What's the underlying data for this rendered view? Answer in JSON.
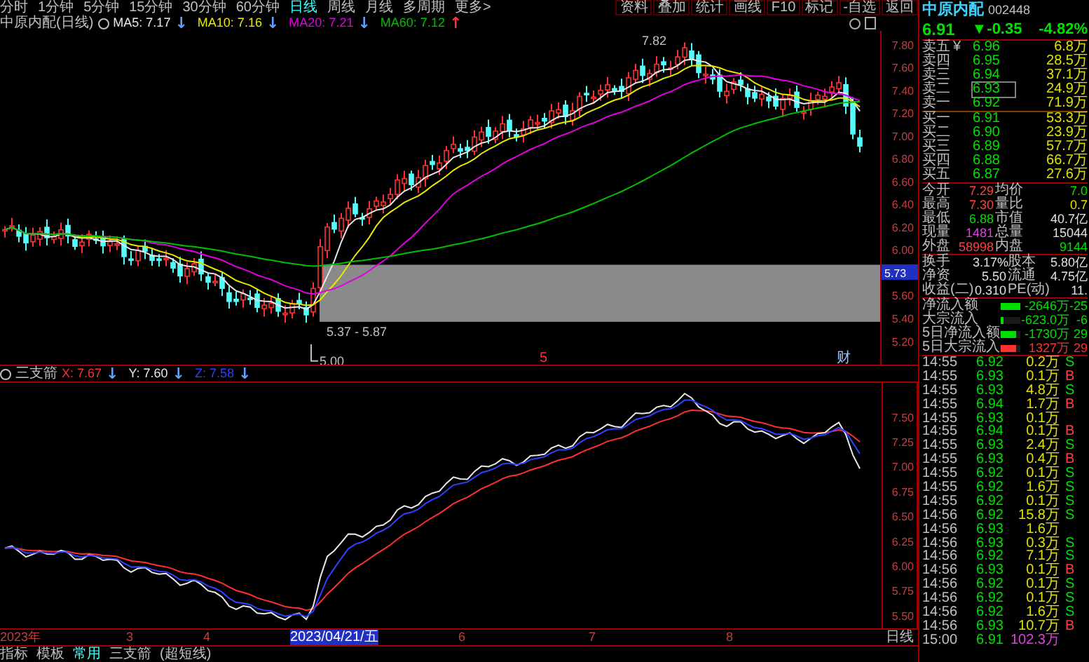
{
  "menu_bar": {
    "periods": [
      {
        "label": "分时",
        "selected": false
      },
      {
        "label": "1分钟",
        "selected": false
      },
      {
        "label": "5分钟",
        "selected": false
      },
      {
        "label": "15分钟",
        "selected": false
      },
      {
        "label": "30分钟",
        "selected": false
      },
      {
        "label": "60分钟",
        "selected": false
      },
      {
        "label": "日线",
        "selected": true
      },
      {
        "label": "周线",
        "selected": false
      },
      {
        "label": "月线",
        "selected": false
      },
      {
        "label": "多周期",
        "selected": false
      },
      {
        "label": "更多>",
        "selected": false
      }
    ],
    "tools": [
      "资料",
      "叠加",
      "统计",
      "画线",
      "F10",
      "标记",
      "-自选",
      "返回"
    ]
  },
  "price_chart": {
    "title": "中原内配(日线)",
    "ma_legend": [
      {
        "label": "MA5: 7.17",
        "arrow": {
          "text": "↓",
          "color": "#60a0ff"
        },
        "color": "#e8e8e8"
      },
      {
        "label": "MA10: 7.16",
        "arrow": {
          "text": "↓",
          "color": "#60a0ff"
        },
        "color": "#e8e800"
      },
      {
        "label": "MA20: 7.21",
        "arrow": {
          "text": "↓",
          "color": "#60a0ff"
        },
        "color": "#e000e0"
      },
      {
        "label": "MA60: 7.12",
        "arrow": {
          "text": "↑",
          "color": "#ff3030"
        },
        "color": "#00c000"
      }
    ],
    "y_labels": [
      "7.80",
      "7.60",
      "7.40",
      "7.20",
      "7.00",
      "6.80",
      "6.60",
      "6.40",
      "6.20",
      "6.00",
      "5.60",
      "5.40",
      "5.20"
    ],
    "cursor_price": "5.73",
    "annotations": [
      {
        "kind": "high",
        "text": "7.82"
      },
      {
        "kind": "gap",
        "text": "5.37 - 5.87"
      },
      {
        "kind": "low",
        "text": "5.00"
      }
    ],
    "event_marks": [
      {
        "text": "5",
        "color": "#ff3030"
      },
      {
        "text": "财",
        "color": "#a0c8ff"
      }
    ]
  },
  "indicator": {
    "name": "三支箭",
    "values": [
      {
        "label": "X: 7.67",
        "arrow": "↓",
        "color": "#ff3030"
      },
      {
        "label": "Y: 7.60",
        "arrow": "↓",
        "color": "#e8e8e8"
      },
      {
        "label": "Z: 7.58",
        "arrow": "↓",
        "color": "#3040ff"
      }
    ],
    "y_labels": [
      "7.50",
      "7.25",
      "7.00",
      "6.75",
      "6.50",
      "6.25",
      "6.00",
      "5.75",
      "5.50"
    ]
  },
  "date_axis": {
    "labels": [
      "2023年",
      "3",
      "4",
      "6",
      "7",
      "8"
    ],
    "cursor_date": "2023/04/21/五",
    "period": "日线"
  },
  "bottom_tabs": [
    {
      "label": "指标",
      "selected": false
    },
    {
      "label": "模板",
      "selected": false
    },
    {
      "label": "常用",
      "selected": true
    },
    {
      "label": "三支箭",
      "selected": false
    },
    {
      "label": "(超短线)",
      "selected": false
    }
  ],
  "quote": {
    "name": "中原内配",
    "code": "002448",
    "price": "6.91",
    "change": "▼-0.35",
    "change_pct": "-4.82%",
    "order_book": [
      {
        "label": "卖五",
        "mark": "¥",
        "price": "6.96",
        "volume": "6.8万",
        "selected": false
      },
      {
        "label": "卖四",
        "price": "6.95",
        "volume": "28.5万",
        "selected": false
      },
      {
        "label": "卖三",
        "price": "6.94",
        "volume": "37.1万",
        "selected": false
      },
      {
        "label": "卖二",
        "price": "6.93",
        "volume": "24.9万",
        "selected": true
      },
      {
        "label": "卖一",
        "price": "6.92",
        "volume": "71.9万",
        "selected": false
      },
      {
        "label": "买一",
        "price": "6.91",
        "volume": "53.3万",
        "selected": false
      },
      {
        "label": "买二",
        "price": "6.90",
        "volume": "23.9万",
        "selected": false
      },
      {
        "label": "买三",
        "price": "6.89",
        "volume": "57.7万",
        "selected": false
      },
      {
        "label": "买四",
        "price": "6.88",
        "volume": "66.7万",
        "selected": false
      },
      {
        "label": "买五",
        "price": "6.87",
        "volume": "27.6万",
        "selected": false
      }
    ],
    "stats": [
      {
        "left": {
          "label": "今开",
          "value": "7.29",
          "color": "#ff4040"
        },
        "right": {
          "label": "均价",
          "value": "7.0",
          "color": "#00e000"
        }
      },
      {
        "left": {
          "label": "最高",
          "value": "7.30",
          "color": "#ff4040"
        },
        "right": {
          "label": "量比",
          "value": "0.7",
          "color": "#e0e000"
        }
      },
      {
        "left": {
          "label": "最低",
          "value": "6.88",
          "color": "#00e000"
        },
        "right": {
          "label": "市值",
          "value": "40.7亿",
          "color": "#e0e0e0"
        }
      },
      {
        "left": {
          "label": "现量",
          "value": "1481",
          "color": "#e040e0"
        },
        "right": {
          "label": "总量",
          "value": "15044",
          "color": "#e0e0e0"
        }
      },
      {
        "left": {
          "label": "外盘",
          "value": "58998",
          "color": "#ff4040"
        },
        "right": {
          "label": "内盘",
          "value": "9144",
          "color": "#00e000"
        }
      }
    ],
    "fundamentals": [
      {
        "label": "换手",
        "value": "3.17%",
        "label2": "股本",
        "value2": "5.80亿"
      },
      {
        "label": "净资",
        "value": "5.50",
        "label2": "流通",
        "value2": "4.75亿"
      },
      {
        "label": "收益(二)",
        "value": "0.310",
        "label2": "PE(动)",
        "value2": "11."
      }
    ],
    "flows": [
      {
        "label": "净流入额",
        "level": 1,
        "color": "#00e000",
        "value": "-2646万",
        "extra": "-25"
      },
      {
        "label": "大宗流入",
        "level": 0.15,
        "color": "#00e000",
        "value": "-623.0万",
        "extra": "-6"
      },
      {
        "label": "5日净流入额",
        "level": 0.8,
        "color": "#00e000",
        "value": "-1730万",
        "extra": "29"
      },
      {
        "label": "5日大宗流入",
        "level": 0.8,
        "color": "#ff3030",
        "value": "1327万",
        "extra": "29"
      }
    ],
    "ticks": [
      {
        "time": "14:55",
        "price": "6.92",
        "volume": "0.2万",
        "side": "S",
        "color": "#00e000",
        "highlight": false
      },
      {
        "time": "14:55",
        "price": "6.93",
        "volume": "0.1万",
        "side": "B",
        "color": "#ff4040",
        "highlight": false
      },
      {
        "time": "14:55",
        "price": "6.93",
        "volume": "4.8万",
        "side": "S",
        "color": "#00e000",
        "highlight": false
      },
      {
        "time": "14:55",
        "price": "6.94",
        "volume": "1.7万",
        "side": "B",
        "color": "#ff4040",
        "highlight": false
      },
      {
        "time": "14:55",
        "price": "6.93",
        "volume": "0.1万",
        "highlight": false
      },
      {
        "time": "14:55",
        "price": "6.94",
        "volume": "0.1万",
        "side": "B",
        "color": "#ff4040",
        "highlight": false
      },
      {
        "time": "14:55",
        "price": "6.93",
        "volume": "2.4万",
        "side": "S",
        "color": "#00e000",
        "highlight": false
      },
      {
        "time": "14:55",
        "price": "6.93",
        "volume": "0.4万",
        "side": "B",
        "color": "#ff4040",
        "highlight": false
      },
      {
        "time": "14:55",
        "price": "6.92",
        "volume": "0.1万",
        "side": "S",
        "color": "#00e000",
        "highlight": false
      },
      {
        "time": "14:55",
        "price": "6.92",
        "volume": "1.6万",
        "side": "S",
        "color": "#00e000",
        "highlight": false
      },
      {
        "time": "14:55",
        "price": "6.92",
        "volume": "0.1万",
        "side": "S",
        "color": "#00e000",
        "highlight": false
      },
      {
        "time": "14:56",
        "price": "6.92",
        "volume": "15.8万",
        "side": "S",
        "color": "#00e000",
        "highlight": false
      },
      {
        "time": "14:56",
        "price": "6.93",
        "volume": "1.6万",
        "highlight": false
      },
      {
        "time": "14:56",
        "price": "6.93",
        "volume": "0.3万",
        "side": "S",
        "color": "#00e000",
        "highlight": false
      },
      {
        "time": "14:56",
        "price": "6.92",
        "volume": "7.1万",
        "side": "S",
        "color": "#00e000",
        "highlight": false
      },
      {
        "time": "14:56",
        "price": "6.93",
        "volume": "0.1万",
        "side": "B",
        "color": "#ff4040",
        "highlight": false
      },
      {
        "time": "14:56",
        "price": "6.92",
        "volume": "0.1万",
        "side": "S",
        "color": "#00e000",
        "highlight": false
      },
      {
        "time": "14:56",
        "price": "6.92",
        "volume": "0.1万",
        "side": "S",
        "color": "#00e000",
        "highlight": false
      },
      {
        "time": "14:56",
        "price": "6.92",
        "volume": "1.6万",
        "side": "S",
        "color": "#00e000",
        "highlight": false
      },
      {
        "time": "14:56",
        "price": "6.93",
        "volume": "10.7万",
        "side": "B",
        "color": "#ff4040",
        "highlight": false
      },
      {
        "time": "15:00",
        "price": "6.91",
        "volume": "102.3万",
        "highlight": true
      }
    ]
  }
}
